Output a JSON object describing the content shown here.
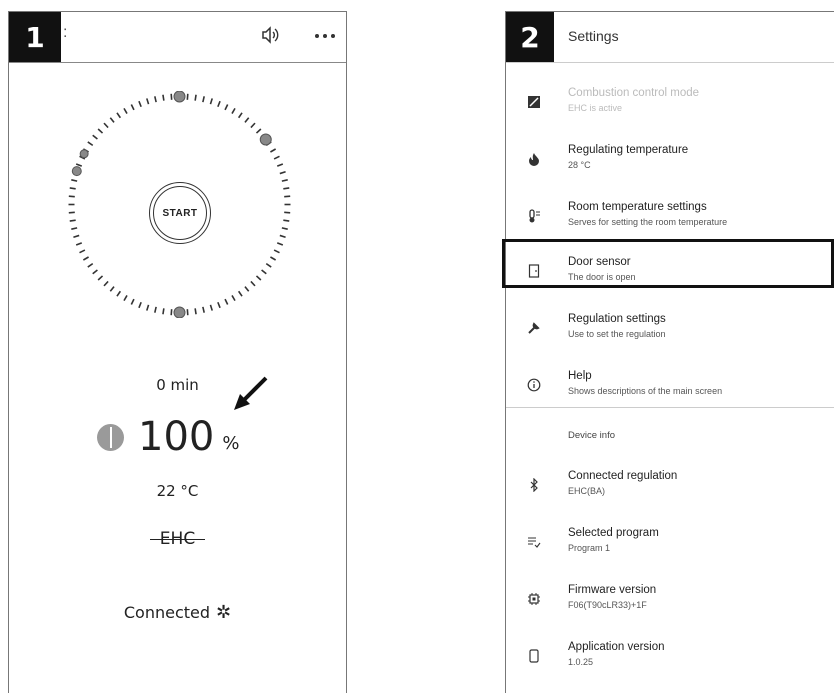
{
  "panel1": {
    "step": "1",
    "header_glyph": ":",
    "icons": {
      "sound": "speaker-icon",
      "more": "more-icon"
    },
    "start_label": "START",
    "time": "0 min",
    "power_value": "100",
    "power_unit": "%",
    "temperature": "22 °C",
    "mode": "EHC",
    "connection": "Connected",
    "connection_glyph": "✲"
  },
  "panel2": {
    "step": "2",
    "title": "Settings",
    "items": [
      {
        "icon": "auto-mode-icon",
        "title": "Combustion control mode",
        "subtitle": "EHC is active",
        "disabled": true
      },
      {
        "icon": "flame-icon",
        "title": "Regulating temperature",
        "subtitle": "28 °C"
      },
      {
        "icon": "thermometer-icon",
        "title": "Room temperature settings",
        "subtitle": "Serves for setting the room temperature"
      },
      {
        "icon": "door-icon",
        "title": "Door sensor",
        "subtitle": "The door is open"
      },
      {
        "icon": "wrench-icon",
        "title": "Regulation settings",
        "subtitle": "Use to set the regulation"
      },
      {
        "icon": "info-icon",
        "title": "Help",
        "subtitle": "Shows descriptions of the main screen"
      }
    ],
    "section": "Device info",
    "device_items": [
      {
        "icon": "bluetooth-icon",
        "title": "Connected regulation",
        "subtitle": "EHC(BA)"
      },
      {
        "icon": "program-list-icon",
        "title": "Selected program",
        "subtitle": "Program 1"
      },
      {
        "icon": "chip-icon",
        "title": "Firmware version",
        "subtitle": "F06(T90cLR33)+1F"
      },
      {
        "icon": "phone-icon",
        "title": "Application version",
        "subtitle": "1.0.25"
      }
    ]
  }
}
